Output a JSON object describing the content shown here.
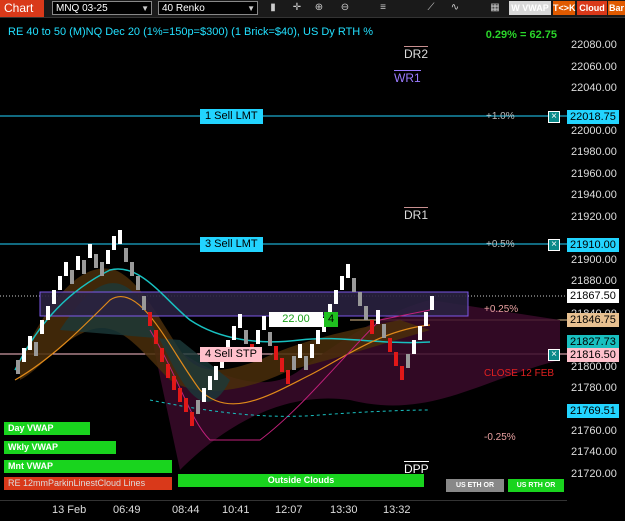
{
  "toolbar": {
    "app_title": "Chart",
    "instrument": "MNQ 03-25",
    "bar_type": "40 Renko",
    "btn_wvwap": "W VWAP",
    "btn_tk": "T<>K",
    "btn_cloud": "Cloud",
    "btn_bar": "Bar",
    "icons": [
      "bars-icon",
      "crosshair-icon",
      "zoom-in-icon",
      "zoom-out-icon",
      "properties-icon",
      "draw-tool-icon",
      "chart-trader-icon"
    ]
  },
  "chart": {
    "header": "RE 40 to 50 (M)NQ Dec 20 (1%=150p=$300) (1 Brick=$40), US Dy RTH %",
    "pct_readout": "0.29% = 62.75",
    "levels": {
      "dr2": "DR2",
      "wr1": "WR1",
      "dr1": "DR1",
      "dpp": "DPP",
      "close": "CLOSE 12 FEB"
    },
    "annotations": {
      "plus1": "+1.0%",
      "plus05": "+0.5%",
      "plus025": "+0.25%",
      "minus025": "-0.25%"
    },
    "orders": {
      "sell1": "1 Sell LMT",
      "sell3": "3 Sell LMT",
      "sell4": "4 Sell STP",
      "pos_value": "22.00",
      "pos_qty": "4"
    },
    "bottom_labels": {
      "day_vwap": "Day VWAP",
      "wkly_vwap": "Wkly VWAP",
      "mnt_vwap": "Mnt VWAP",
      "legend": "RE 12mmParkinLinestCloud Lines",
      "outside": "Outside Clouds",
      "us_eth": "US ETH OR",
      "us_rth": "US RTH OR"
    }
  },
  "price_axis": {
    "ticks": [
      "22080.00",
      "22060.00",
      "22040.00",
      "22000.00",
      "21980.00",
      "21960.00",
      "21940.00",
      "21920.00",
      "21900.00",
      "21880.00",
      "21860.00",
      "21840.00",
      "21800.00",
      "21780.00",
      "21760.00",
      "21740.00",
      "21720.00"
    ],
    "tags": {
      "t1": "22018.75",
      "t2": "21910.00",
      "t3": "21867.50",
      "t4": "21846.75",
      "t5": "21827.73",
      "t6": "21816.50",
      "t7": "21769.51"
    }
  },
  "x_axis": {
    "ticks": [
      "13 Feb",
      "06:49",
      "08:44",
      "10:41",
      "12:07",
      "13:30",
      "13:32"
    ]
  },
  "colors": {
    "order_line": "#22d4ff",
    "sell_stp": "#ffc0cb",
    "vwap_green": "#19d41e",
    "cloud_red": "#d9391a"
  }
}
